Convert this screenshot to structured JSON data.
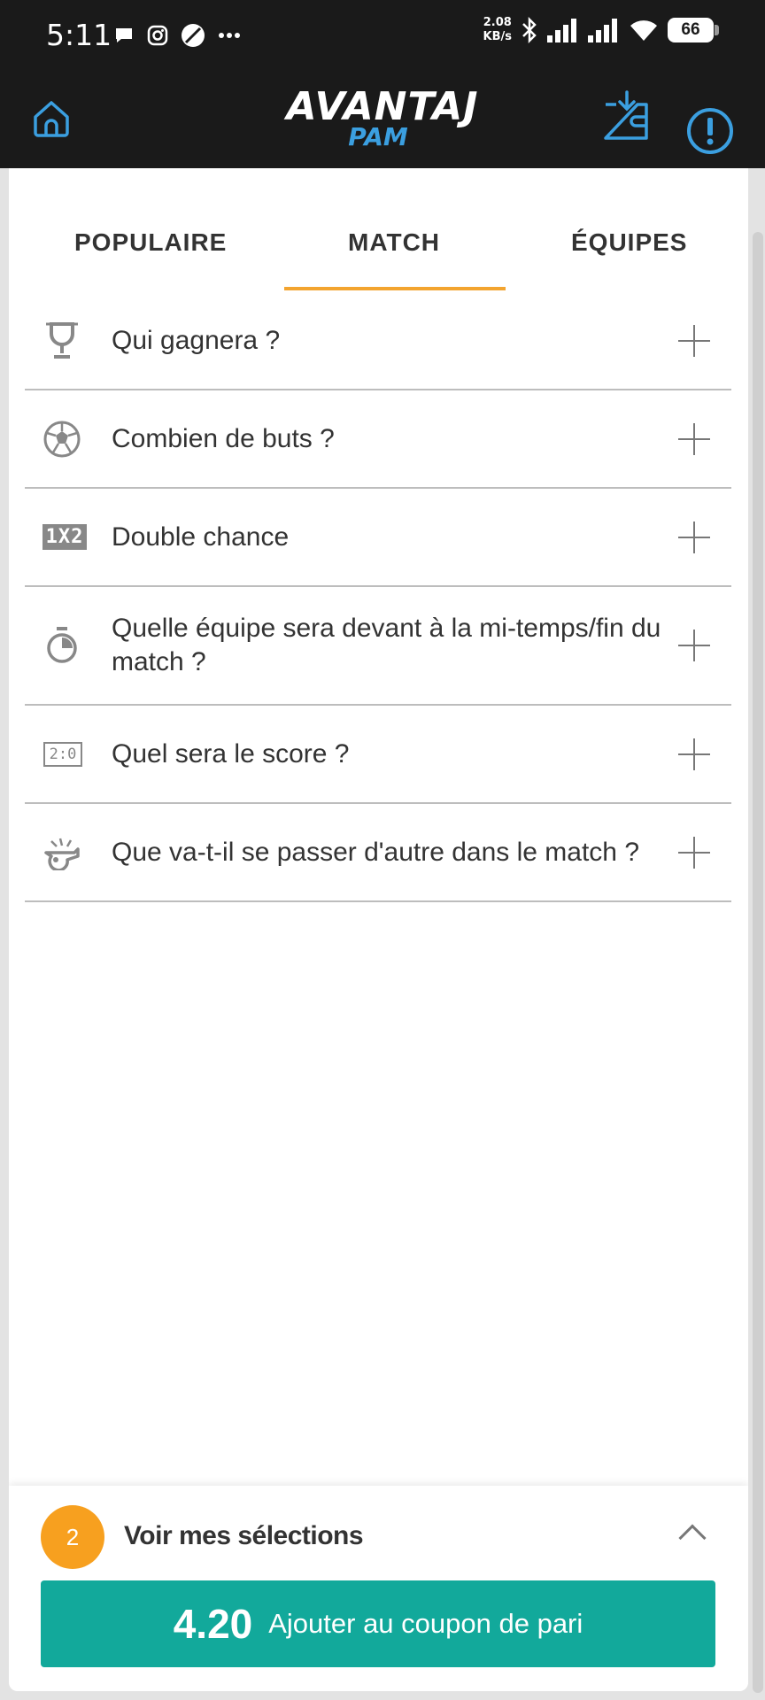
{
  "status_bar": {
    "time": "5:11",
    "net_speed_value": "2.08",
    "net_speed_unit": "KB/s",
    "battery": "66"
  },
  "header": {
    "logo_main": "AVANTAJ",
    "logo_sub": "PAM"
  },
  "tabs": [
    {
      "label": "POPULAIRE"
    },
    {
      "label": "MATCH"
    },
    {
      "label": "ÉQUIPES"
    }
  ],
  "active_tab": "MATCH",
  "rows": [
    {
      "label": "Qui gagnera ?",
      "icon": "trophy-icon"
    },
    {
      "label": "Combien de buts ?",
      "icon": "soccer-ball-icon"
    },
    {
      "label": "Double chance",
      "icon": "1x2-icon"
    },
    {
      "label": "Quelle équipe sera devant à la mi-temps/fin du match ?",
      "icon": "stopwatch-icon"
    },
    {
      "label": "Quel sera le score ?",
      "icon": "scoreboard-icon"
    },
    {
      "label": "Que va-t-il se passer d'autre dans le match ?",
      "icon": "whistle-icon"
    }
  ],
  "icon_text": {
    "onextwo": "1X2",
    "score": "2:0"
  },
  "bottom": {
    "selection_count": "2",
    "selections_label": "Voir mes sélections",
    "odds": "4.20",
    "add_label": "Ajouter au coupon de pari"
  },
  "colors": {
    "accent_tab": "#f3a42f",
    "badge": "#f7a01f",
    "button": "#12a99b",
    "header_icons": "#3b9fe0"
  }
}
